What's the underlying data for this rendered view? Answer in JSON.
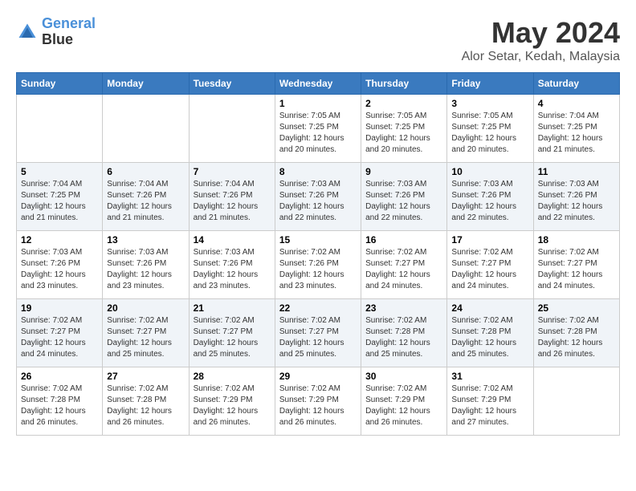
{
  "logo": {
    "line1": "General",
    "line2": "Blue"
  },
  "title": "May 2024",
  "location": "Alor Setar, Kedah, Malaysia",
  "days_of_week": [
    "Sunday",
    "Monday",
    "Tuesday",
    "Wednesday",
    "Thursday",
    "Friday",
    "Saturday"
  ],
  "weeks": [
    [
      {
        "day": "",
        "info": ""
      },
      {
        "day": "",
        "info": ""
      },
      {
        "day": "",
        "info": ""
      },
      {
        "day": "1",
        "info": "Sunrise: 7:05 AM\nSunset: 7:25 PM\nDaylight: 12 hours\nand 20 minutes."
      },
      {
        "day": "2",
        "info": "Sunrise: 7:05 AM\nSunset: 7:25 PM\nDaylight: 12 hours\nand 20 minutes."
      },
      {
        "day": "3",
        "info": "Sunrise: 7:05 AM\nSunset: 7:25 PM\nDaylight: 12 hours\nand 20 minutes."
      },
      {
        "day": "4",
        "info": "Sunrise: 7:04 AM\nSunset: 7:25 PM\nDaylight: 12 hours\nand 21 minutes."
      }
    ],
    [
      {
        "day": "5",
        "info": "Sunrise: 7:04 AM\nSunset: 7:25 PM\nDaylight: 12 hours\nand 21 minutes."
      },
      {
        "day": "6",
        "info": "Sunrise: 7:04 AM\nSunset: 7:26 PM\nDaylight: 12 hours\nand 21 minutes."
      },
      {
        "day": "7",
        "info": "Sunrise: 7:04 AM\nSunset: 7:26 PM\nDaylight: 12 hours\nand 21 minutes."
      },
      {
        "day": "8",
        "info": "Sunrise: 7:03 AM\nSunset: 7:26 PM\nDaylight: 12 hours\nand 22 minutes."
      },
      {
        "day": "9",
        "info": "Sunrise: 7:03 AM\nSunset: 7:26 PM\nDaylight: 12 hours\nand 22 minutes."
      },
      {
        "day": "10",
        "info": "Sunrise: 7:03 AM\nSunset: 7:26 PM\nDaylight: 12 hours\nand 22 minutes."
      },
      {
        "day": "11",
        "info": "Sunrise: 7:03 AM\nSunset: 7:26 PM\nDaylight: 12 hours\nand 22 minutes."
      }
    ],
    [
      {
        "day": "12",
        "info": "Sunrise: 7:03 AM\nSunset: 7:26 PM\nDaylight: 12 hours\nand 23 minutes."
      },
      {
        "day": "13",
        "info": "Sunrise: 7:03 AM\nSunset: 7:26 PM\nDaylight: 12 hours\nand 23 minutes."
      },
      {
        "day": "14",
        "info": "Sunrise: 7:03 AM\nSunset: 7:26 PM\nDaylight: 12 hours\nand 23 minutes."
      },
      {
        "day": "15",
        "info": "Sunrise: 7:02 AM\nSunset: 7:26 PM\nDaylight: 12 hours\nand 23 minutes."
      },
      {
        "day": "16",
        "info": "Sunrise: 7:02 AM\nSunset: 7:27 PM\nDaylight: 12 hours\nand 24 minutes."
      },
      {
        "day": "17",
        "info": "Sunrise: 7:02 AM\nSunset: 7:27 PM\nDaylight: 12 hours\nand 24 minutes."
      },
      {
        "day": "18",
        "info": "Sunrise: 7:02 AM\nSunset: 7:27 PM\nDaylight: 12 hours\nand 24 minutes."
      }
    ],
    [
      {
        "day": "19",
        "info": "Sunrise: 7:02 AM\nSunset: 7:27 PM\nDaylight: 12 hours\nand 24 minutes."
      },
      {
        "day": "20",
        "info": "Sunrise: 7:02 AM\nSunset: 7:27 PM\nDaylight: 12 hours\nand 25 minutes."
      },
      {
        "day": "21",
        "info": "Sunrise: 7:02 AM\nSunset: 7:27 PM\nDaylight: 12 hours\nand 25 minutes."
      },
      {
        "day": "22",
        "info": "Sunrise: 7:02 AM\nSunset: 7:27 PM\nDaylight: 12 hours\nand 25 minutes."
      },
      {
        "day": "23",
        "info": "Sunrise: 7:02 AM\nSunset: 7:28 PM\nDaylight: 12 hours\nand 25 minutes."
      },
      {
        "day": "24",
        "info": "Sunrise: 7:02 AM\nSunset: 7:28 PM\nDaylight: 12 hours\nand 25 minutes."
      },
      {
        "day": "25",
        "info": "Sunrise: 7:02 AM\nSunset: 7:28 PM\nDaylight: 12 hours\nand 26 minutes."
      }
    ],
    [
      {
        "day": "26",
        "info": "Sunrise: 7:02 AM\nSunset: 7:28 PM\nDaylight: 12 hours\nand 26 minutes."
      },
      {
        "day": "27",
        "info": "Sunrise: 7:02 AM\nSunset: 7:28 PM\nDaylight: 12 hours\nand 26 minutes."
      },
      {
        "day": "28",
        "info": "Sunrise: 7:02 AM\nSunset: 7:29 PM\nDaylight: 12 hours\nand 26 minutes."
      },
      {
        "day": "29",
        "info": "Sunrise: 7:02 AM\nSunset: 7:29 PM\nDaylight: 12 hours\nand 26 minutes."
      },
      {
        "day": "30",
        "info": "Sunrise: 7:02 AM\nSunset: 7:29 PM\nDaylight: 12 hours\nand 26 minutes."
      },
      {
        "day": "31",
        "info": "Sunrise: 7:02 AM\nSunset: 7:29 PM\nDaylight: 12 hours\nand 27 minutes."
      },
      {
        "day": "",
        "info": ""
      }
    ]
  ]
}
